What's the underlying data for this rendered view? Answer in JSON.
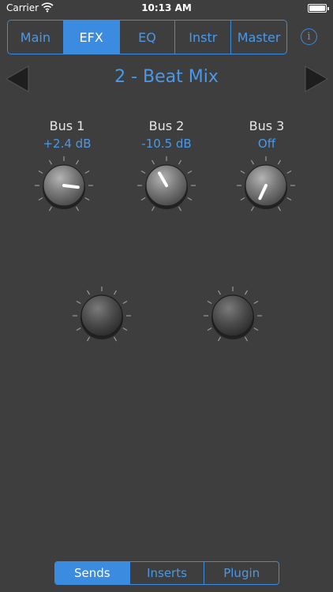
{
  "status_bar": {
    "carrier": "Carrier",
    "time": "10:13 AM"
  },
  "top_tabs": [
    {
      "label": "Main"
    },
    {
      "label": "EFX",
      "selected": true
    },
    {
      "label": "EQ"
    },
    {
      "label": "Instr"
    },
    {
      "label": "Master"
    }
  ],
  "info_glyph": "i",
  "patch": {
    "title": "2 - Beat Mix"
  },
  "buses": [
    {
      "name": "Bus 1",
      "value": "+2.4 dB",
      "knob_angle_deg": 97
    },
    {
      "name": "Bus 2",
      "value": "-10.5 dB",
      "knob_angle_deg": -30
    },
    {
      "name": "Bus 3",
      "value": "Off",
      "knob_angle_deg": 205
    }
  ],
  "bottom_tabs": [
    {
      "label": "Sends",
      "selected": true
    },
    {
      "label": "Inserts"
    },
    {
      "label": "Plugin"
    }
  ],
  "colors": {
    "accent": "#3b8be0",
    "background": "#3e3e3e"
  },
  "icons": {
    "prev": "triangle-left-icon",
    "next": "triangle-right-icon",
    "info": "info-circle-icon",
    "wifi": "wifi-icon",
    "battery": "battery-icon"
  }
}
